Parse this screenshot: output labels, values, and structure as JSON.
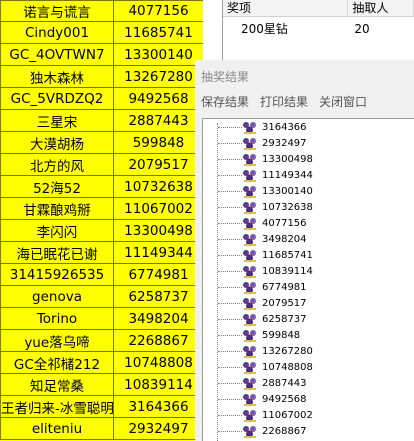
{
  "sheet": {
    "rows": [
      {
        "name": "诺言与谎言",
        "id": "4077156"
      },
      {
        "name": "Cindy001",
        "id": "11685741"
      },
      {
        "name": "GC_4OVTWN7",
        "id": "13300140"
      },
      {
        "name": "独木森林",
        "id": "13267280"
      },
      {
        "name": "GC_5VRDZQ2",
        "id": "9492568"
      },
      {
        "name": "三星宋",
        "id": "2887443"
      },
      {
        "name": "大漠胡杨",
        "id": "599848"
      },
      {
        "name": "北方的风",
        "id": "2079517"
      },
      {
        "name": "52海52",
        "id": "10732638"
      },
      {
        "name": "甘霖酿鸡掰",
        "id": "11067002"
      },
      {
        "name": "李闪闪",
        "id": "13300498"
      },
      {
        "name": "海已眠花已谢",
        "id": "11149344"
      },
      {
        "name": "31415926535",
        "id": "6774981"
      },
      {
        "name": "genova",
        "id": "6258737"
      },
      {
        "name": "Torino",
        "id": "3498204"
      },
      {
        "name": "yue落乌啼",
        "id": "2268867"
      },
      {
        "name": "GC全祁槠212",
        "id": "10748808"
      },
      {
        "name": "知足常桑",
        "id": "10839114"
      },
      {
        "name": "王者归来-冰雪聪明",
        "id": "3164366"
      },
      {
        "name": "eliteniu",
        "id": "2932497"
      }
    ]
  },
  "prize_table": {
    "headers": [
      "奖项",
      "抽取人"
    ],
    "rows": [
      {
        "prize": "200星钻",
        "count": "20"
      }
    ]
  },
  "dialog": {
    "title": "抽奖结果",
    "menu": [
      "保存结果",
      "打印结果",
      "关闭窗口"
    ],
    "results": [
      "3164366",
      "2932497",
      "13300498",
      "11149344",
      "13300140",
      "10732638",
      "4077156",
      "3498204",
      "11685741",
      "10839114",
      "6774981",
      "2079517",
      "6258737",
      "599848",
      "13267280",
      "10748808",
      "2887443",
      "9492568",
      "11067002",
      "2268867"
    ]
  },
  "colors": {
    "sheet_fill": "#ffff00",
    "icon_purple": "#5a3c8a"
  }
}
